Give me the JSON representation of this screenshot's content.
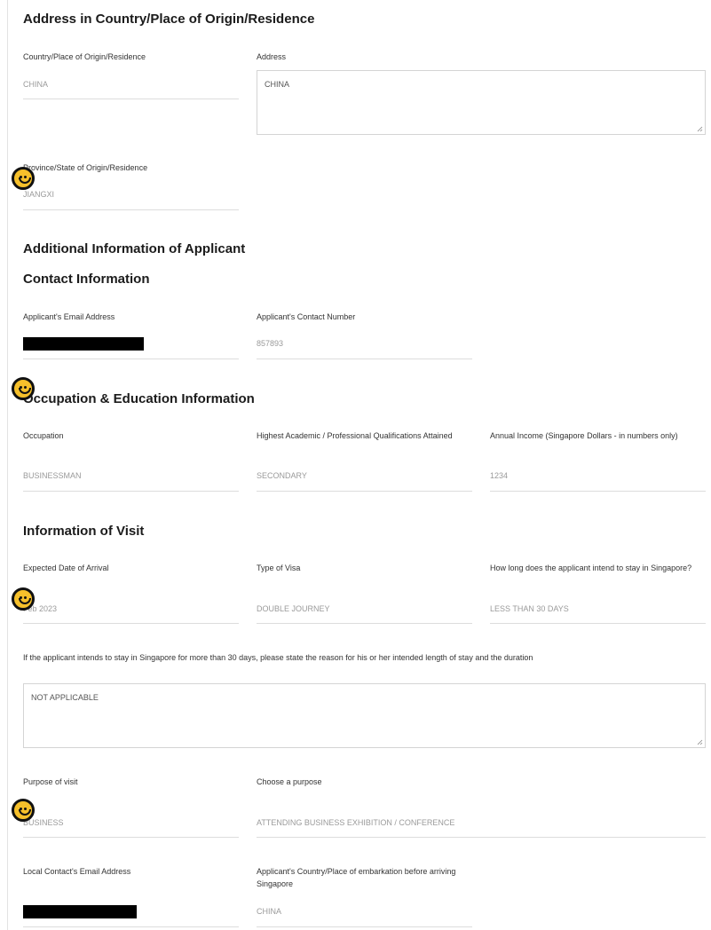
{
  "address_section": {
    "heading": "Address in Country/Place of Origin/Residence",
    "country": {
      "label": "Country/Place of Origin/Residence",
      "value": "CHINA"
    },
    "address": {
      "label": "Address",
      "value": "CHINA"
    },
    "province": {
      "label": "Province/State of Origin/Residence",
      "value": "JIANGXI"
    }
  },
  "additional_section": {
    "heading": "Additional Information of Applicant"
  },
  "contact_section": {
    "heading": "Contact Information",
    "email": {
      "label": "Applicant's Email Address",
      "value": ""
    },
    "phone": {
      "label": "Applicant's Contact Number",
      "value": "857893"
    }
  },
  "occupation_section": {
    "heading": "Occupation & Education Information",
    "occupation": {
      "label": "Occupation",
      "value": "BUSINESSMAN"
    },
    "qualification": {
      "label": "Highest Academic / Professional Qualifications Attained",
      "value": "SECONDARY"
    },
    "income": {
      "label": "Annual Income (Singapore Dollars - in numbers only)",
      "value": "1234"
    }
  },
  "visit_section": {
    "heading": "Information of Visit",
    "arrival": {
      "label": "Expected Date of Arrival",
      "value": "Feb 2023"
    },
    "visa_type": {
      "label": "Type of Visa",
      "value": "DOUBLE JOURNEY"
    },
    "stay": {
      "label": "How long does the applicant intend to stay in Singapore?",
      "value": "LESS THAN 30 DAYS"
    },
    "reason": {
      "label": "If the applicant intends to stay in Singapore for more than 30 days, please state the reason for his or her intended length of stay and the duration",
      "value": "NOT APPLICABLE"
    },
    "purpose": {
      "label": "Purpose of visit",
      "value": "BUSINESS"
    },
    "choose_purpose": {
      "label": "Choose a purpose",
      "value": "ATTENDING BUSINESS EXHIBITION / CONFERENCE"
    },
    "local_email": {
      "label": "Local Contact's Email Address",
      "value": ""
    },
    "embarkation": {
      "label": "Applicant's Country/Place of embarkation before arriving Singapore",
      "value": "CHINA"
    }
  },
  "colors": {
    "heading": "#1b1b1b",
    "label": "#333333",
    "value": "#9a9a9a",
    "underline": "#dddddd",
    "marker": "#f6c02b"
  },
  "icons": [
    "smiley-marker-icon",
    "resize-grip-icon"
  ]
}
